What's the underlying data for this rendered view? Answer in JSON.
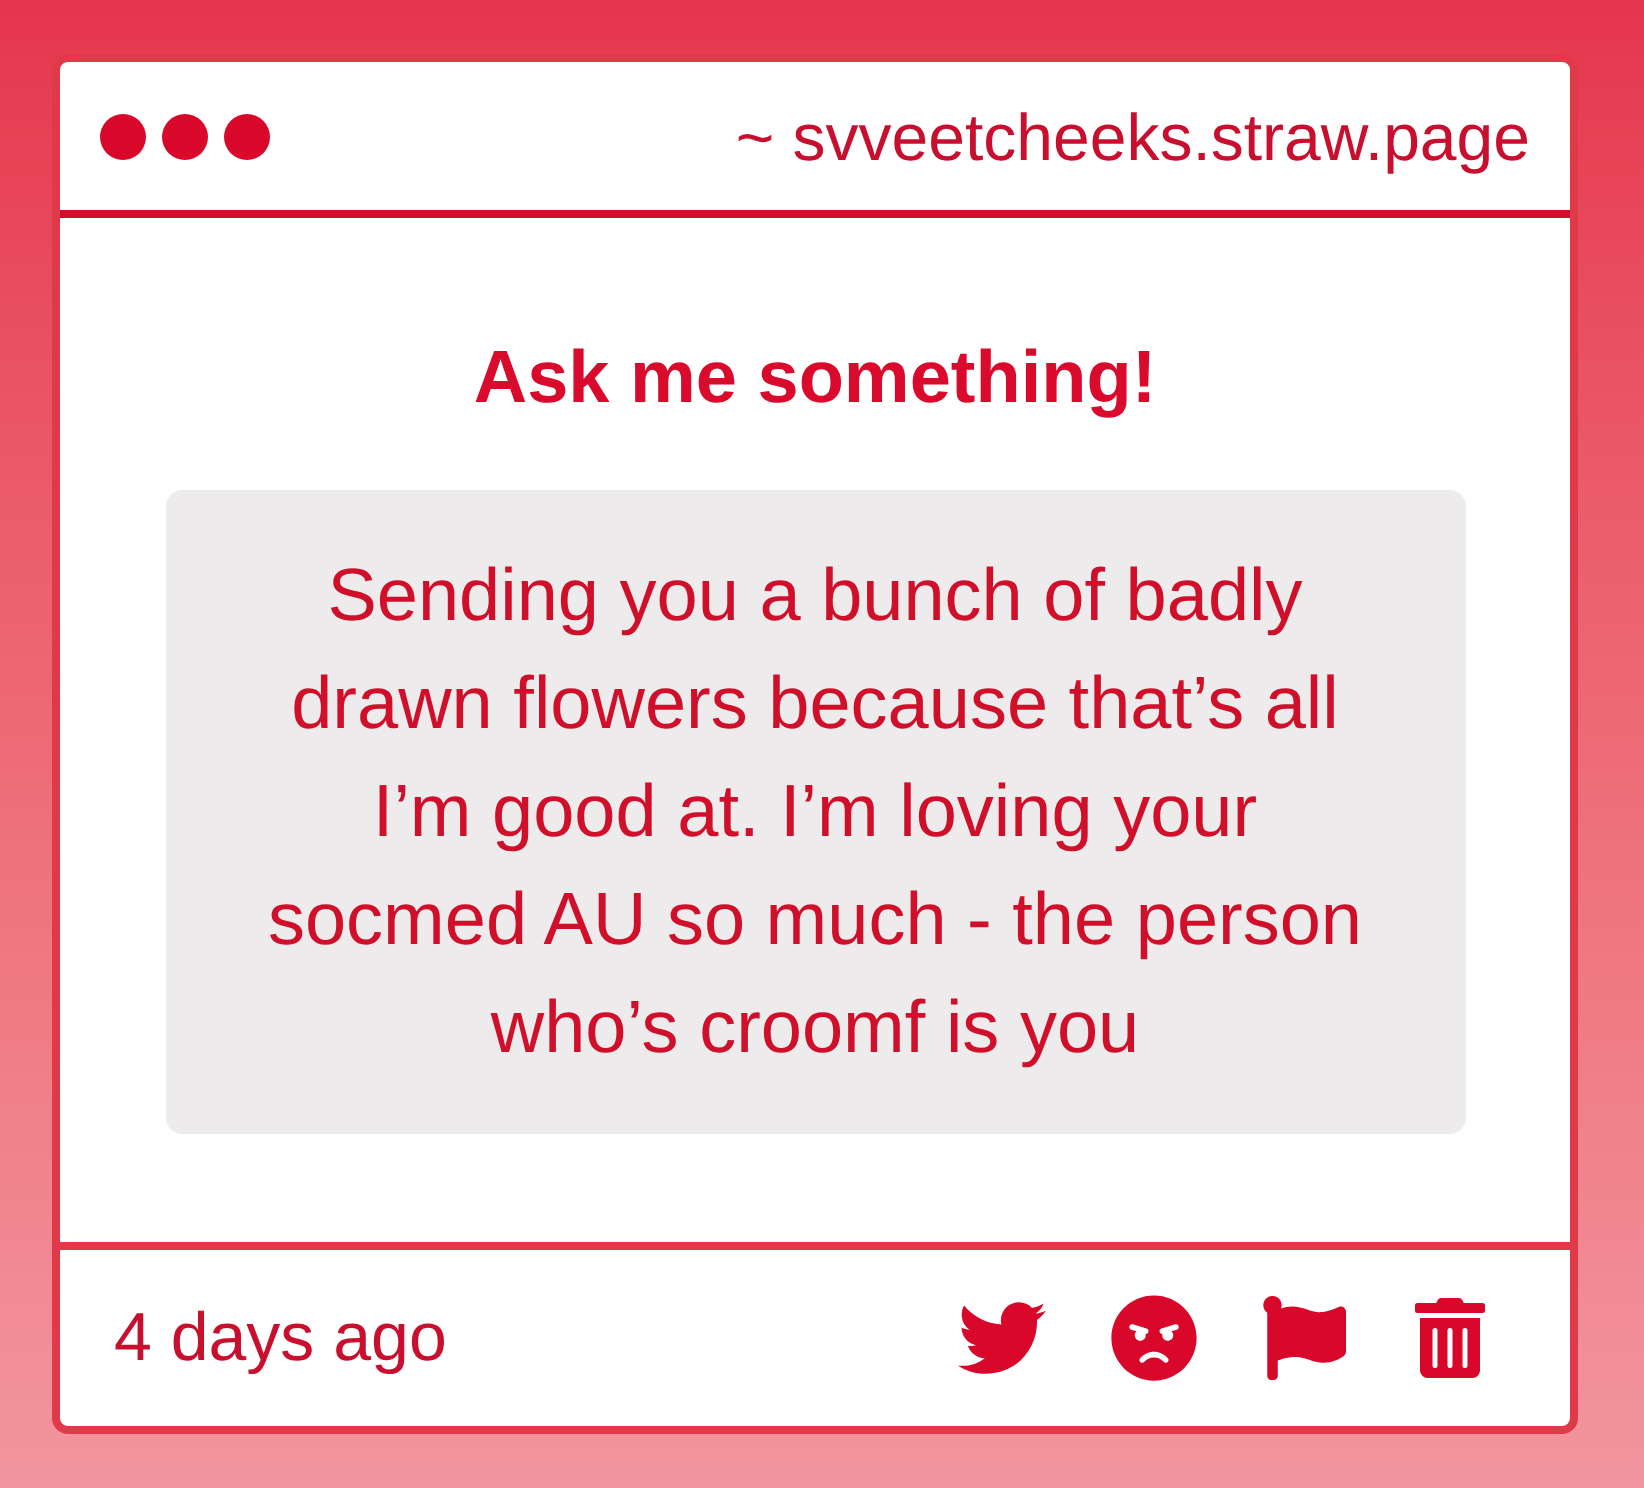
{
  "header": {
    "url": "~ svveetcheeks.straw.page"
  },
  "prompt": {
    "title": "Ask me something!",
    "message": "Sending you a bunch of badly drawn flowers because that’s all I’m good at. I’m loving your socmed AU so much - the person who’s croomf is you"
  },
  "footer": {
    "time": "4 days ago"
  }
}
